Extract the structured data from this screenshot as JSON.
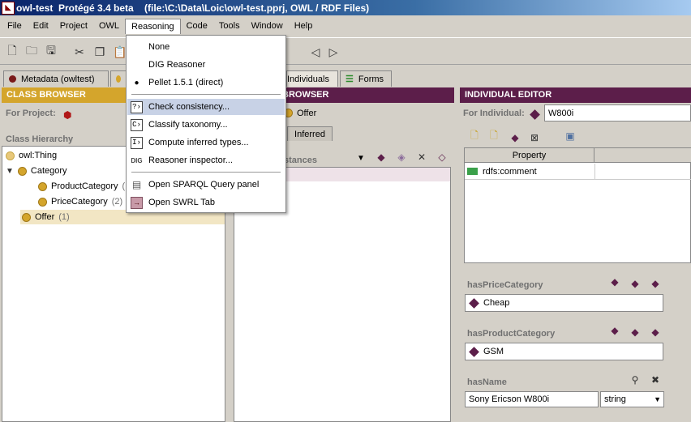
{
  "window": {
    "title": "owl-test  Protégé 3.4 beta    (file:\\C:\\Data\\Loic\\owl-test.pprj, OWL / RDF Files)"
  },
  "menubar": [
    "File",
    "Edit",
    "Project",
    "OWL",
    "Reasoning",
    "Code",
    "Tools",
    "Window",
    "Help"
  ],
  "tabs": {
    "metadata": "Metadata (owltest)",
    "individuals": "Individuals",
    "forms": "Forms"
  },
  "class_browser": {
    "header": "CLASS BROWSER",
    "for_project_label": "For Project:",
    "hierarchy_label": "Class Hierarchy",
    "tree": {
      "root": "owl:Thing",
      "category": "Category",
      "product_category": "ProductCategory",
      "product_category_count": "(",
      "price_category": "PriceCategory",
      "price_category_count": "(2)",
      "offer": "Offer",
      "offer_count": "(1)"
    }
  },
  "instance_browser": {
    "header": "BROWSER",
    "for_class": "Offer",
    "inferred_tab": "Inferred",
    "instances_label": "stances"
  },
  "individual_editor": {
    "header": "INDIVIDUAL EDITOR",
    "for_individual_label": "For Individual:",
    "individual_name": "W800i",
    "table_header_property": "Property",
    "table_row_property": "rdfs:comment",
    "slots": {
      "price_label": "hasPriceCategory",
      "price_value": "Cheap",
      "product_label": "hasProductCategory",
      "product_value": "GSM",
      "name_label": "hasName",
      "name_value": "Sony Ericson W800i",
      "name_type": "string"
    }
  },
  "reasoning_menu": {
    "none": "None",
    "dig": "DIG Reasoner",
    "pellet": "Pellet 1.5.1 (direct)",
    "check": "Check consistency...",
    "classify": "Classify taxonomy...",
    "compute": "Compute inferred types...",
    "inspector": "Reasoner inspector...",
    "sparql": "Open SPARQL Query panel",
    "swrl": "Open SWRL Tab",
    "dig_icon_text": "DIG"
  },
  "colors": {
    "class_header": "#d4a52c",
    "individual_header": "#5c1e4a",
    "menu_highlight": "#c8d2e6"
  }
}
